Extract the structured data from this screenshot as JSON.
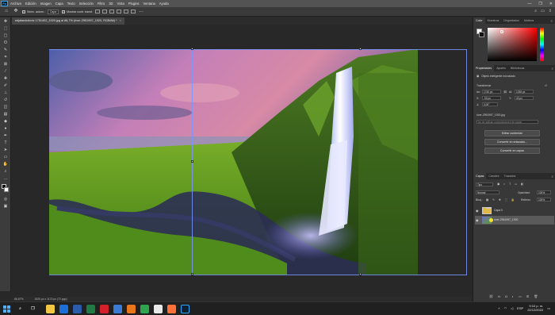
{
  "app": {
    "logo": "Ps"
  },
  "menubar": {
    "items": [
      "Archivo",
      "Edición",
      "Imagen",
      "Capa",
      "Texto",
      "Selección",
      "Filtro",
      "3D",
      "Vista",
      "Plugins",
      "Ventana",
      "Ayuda"
    ],
    "window_controls": [
      "—",
      "❐",
      "✕"
    ]
  },
  "options_bar": {
    "auto_select_label": "Selec. autom.:",
    "auto_select_target": "Capa",
    "transform_controls_label": "Mostrar contr. transf."
  },
  "document": {
    "tab_title": "edjalandofonic 1751402_1920.jpg al 66,7% (river-2951997_1920, RGB/8#) *",
    "tab_close": "×"
  },
  "status": {
    "zoom": "66,67%",
    "doc_info": "1920 px x 1173 px (72 ppp)"
  },
  "color_panel": {
    "tabs": [
      "Color",
      "Muestras",
      "Degradados",
      "Motivos"
    ]
  },
  "properties_panel": {
    "tabs": [
      "Propiedades",
      "Ajustes",
      "Bibliotecas"
    ],
    "object_type": "Objeto inteligente incrustado",
    "transform_label": "Transformar",
    "w_label": "An:",
    "w_value": "1740 px",
    "h_label": "Al:",
    "h_value": "1036 px",
    "x_label": "X:",
    "x_value": "-90 px",
    "y_label": "Y:",
    "y_value": "43 px",
    "angle_value": "0,00°",
    "source_file": "river-2951997_1920.jpg",
    "comps_placeholder": "No se aplican composiciones de capas",
    "btn_edit": "Editar contenido",
    "btn_convert_linked": "Convertir en enlazado...",
    "btn_convert_layers": "Convertir en capas"
  },
  "layers_panel": {
    "tabs": [
      "Capas",
      "Canales",
      "Trazados"
    ],
    "filter_kind": "Tipo",
    "blend_mode": "Normal",
    "opacity_label": "Opacidad:",
    "opacity_value": "100%",
    "lock_label": "Bloq.:",
    "fill_label": "Relleno:",
    "fill_value": "100%",
    "layers": [
      {
        "name": "Capa 0",
        "selected": false
      },
      {
        "name": "river-2951997_1920",
        "selected": true
      }
    ]
  },
  "taskbar": {
    "time": "9:10 p. m.",
    "date": "22/12/2022",
    "language": "ESP",
    "apps": [
      {
        "icon": "file-explorer-icon",
        "color": "#f2c744"
      },
      {
        "icon": "mail-icon",
        "color": "#1c6fd6"
      },
      {
        "icon": "word-icon",
        "color": "#2b5ba9"
      },
      {
        "icon": "excel-icon",
        "color": "#1f7a43"
      },
      {
        "icon": "opera-icon",
        "color": "#d4202a"
      },
      {
        "icon": "photos-icon",
        "color": "#3a7bd5"
      },
      {
        "icon": "vlc-icon",
        "color": "#e8761b"
      },
      {
        "icon": "corel-icon",
        "color": "#2ea44f"
      },
      {
        "icon": "chrome-icon",
        "color": "#e8e8e8"
      },
      {
        "icon": "firefox-icon",
        "color": "#ff7139"
      },
      {
        "icon": "photoshop-icon",
        "color": "#0b1f33"
      }
    ]
  }
}
